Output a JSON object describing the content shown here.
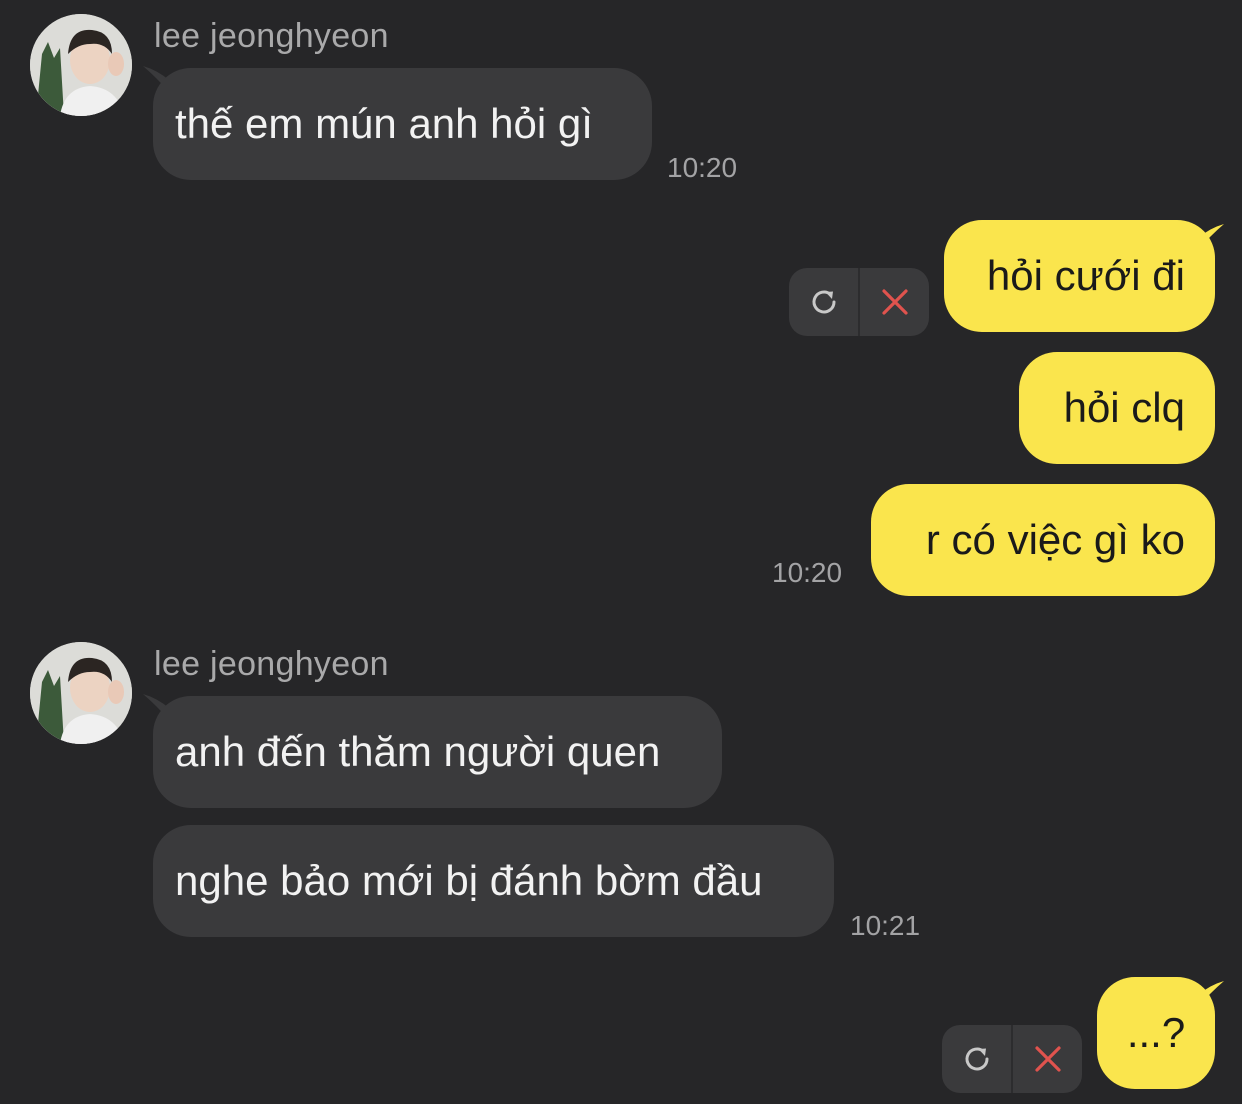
{
  "messages": [
    {
      "group": "incoming",
      "sender": "lee jeonghyeon",
      "avatar_icon": "profile-photo",
      "bubbles": [
        "thế em mún anh hỏi gì"
      ],
      "time": "10:20"
    },
    {
      "group": "outgoing",
      "bubbles": [
        "hỏi cưới đi",
        "hỏi clq",
        "r có việc gì ko"
      ],
      "failed_controls": {
        "retry_icon": "refresh-icon",
        "delete_icon": "close-icon"
      },
      "time": "10:20"
    },
    {
      "group": "incoming",
      "sender": "lee jeonghyeon",
      "avatar_icon": "profile-photo",
      "bubbles": [
        "anh đến thăm người quen",
        "nghe bảo mới bị đánh bờm đầu"
      ],
      "time": "10:21"
    },
    {
      "group": "outgoing",
      "bubbles": [
        "...?"
      ],
      "failed_controls": {
        "retry_icon": "refresh-icon",
        "delete_icon": "close-icon"
      }
    }
  ],
  "colors": {
    "background": "#262628",
    "incoming_bubble": "#3a3a3c",
    "outgoing_bubble": "#fae54d",
    "delete_icon": "#e0534e",
    "timestamp": "#a3a3a5"
  }
}
